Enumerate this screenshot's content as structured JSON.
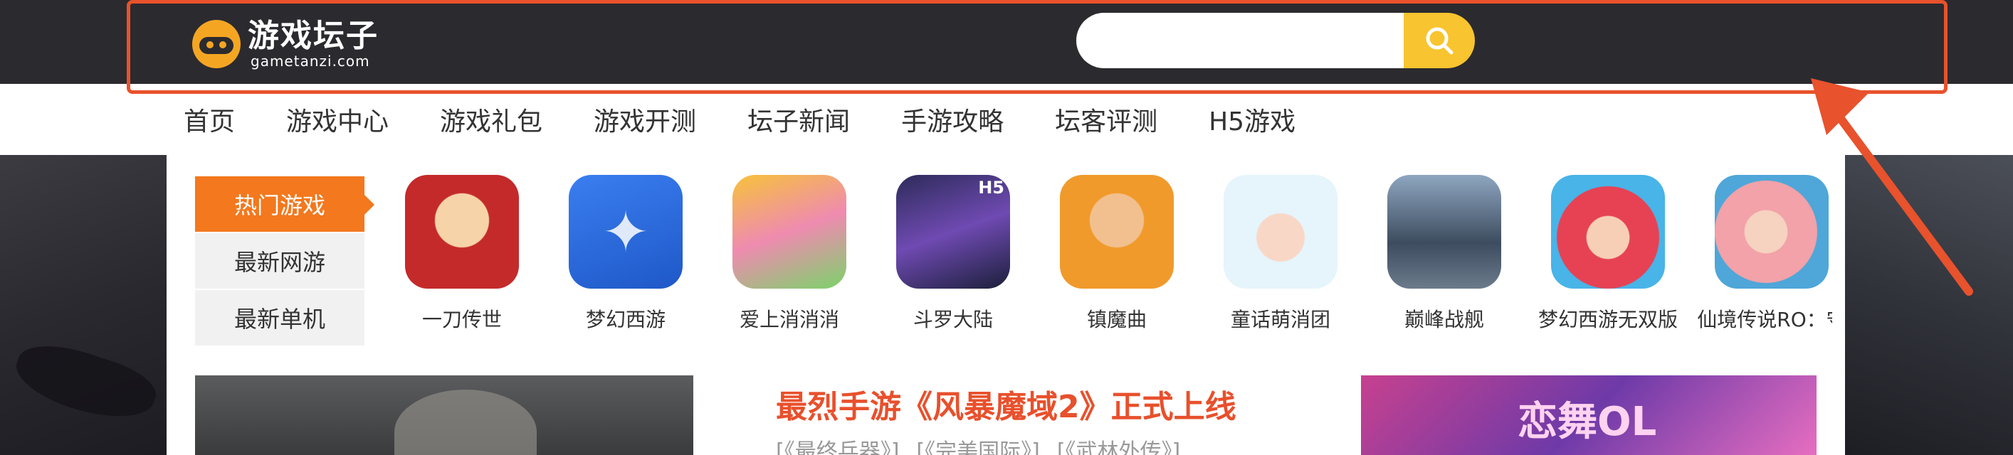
{
  "header": {
    "logo_cn": "游戏坛子",
    "logo_en": "gametanzi.com",
    "search_placeholder": ""
  },
  "nav": {
    "items": [
      "首页",
      "游戏中心",
      "游戏礼包",
      "游戏开测",
      "坛子新闻",
      "手游攻略",
      "坛客评测",
      "H5游戏"
    ]
  },
  "tabs": {
    "items": [
      "热门游戏",
      "最新网游",
      "最新单机"
    ],
    "active_index": 0
  },
  "games": [
    {
      "name": "一刀传世",
      "icon": "jackie-chan-icon"
    },
    {
      "name": "梦幻西游",
      "icon": "dream-character-icon"
    },
    {
      "name": "爱上消消消",
      "icon": "bear-puzzle-icon"
    },
    {
      "name": "斗罗大陆",
      "icon": "warrior-h5-icon",
      "badge": "H5"
    },
    {
      "name": "镇魔曲",
      "icon": "monk-icon"
    },
    {
      "name": "童话萌消团",
      "icon": "cartoon-girl-icon"
    },
    {
      "name": "巅峰战舰",
      "icon": "warship-icon"
    },
    {
      "name": "梦幻西游无双版",
      "icon": "red-hair-hero-icon"
    },
    {
      "name": "仙境传说RO：守",
      "icon": "anime-girl-icon"
    }
  ],
  "feature": {
    "headline": "最烈手游《风暴魔域2》正式上线",
    "tags": [
      "[《最终兵器》]",
      "[《完美国际》]",
      "[《武林外传》]"
    ]
  },
  "colors": {
    "header_bg": "#2b2a2f",
    "accent_orange": "#f3781e",
    "search_button": "#f8c42f",
    "headline_red": "#e8502c",
    "annotation_red": "#e8522c"
  }
}
